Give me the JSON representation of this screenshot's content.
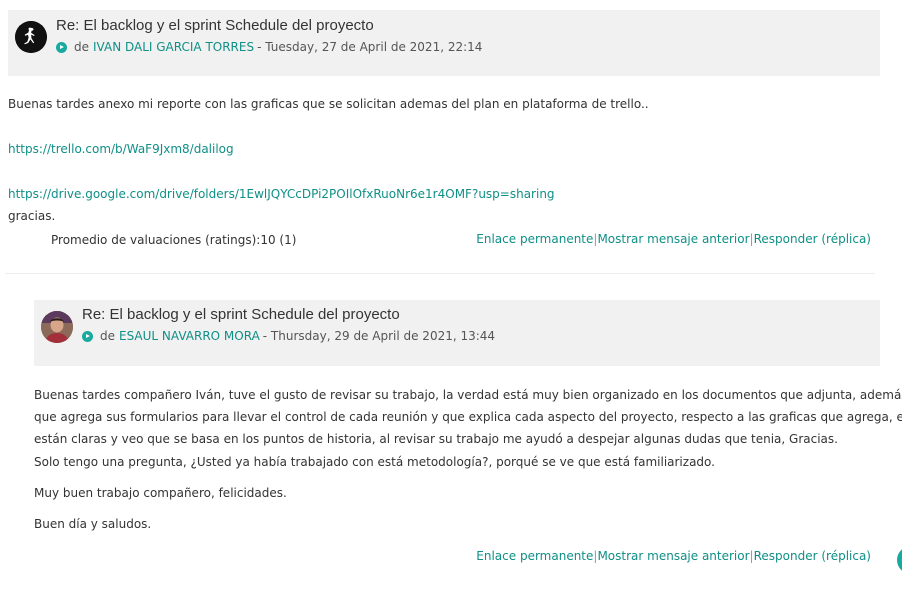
{
  "posts": [
    {
      "subject": "Re: El backlog y el sprint Schedule del proyecto",
      "by_prefix": "de",
      "author": "IVAN DALI GARCIA TORRES",
      "date": "- Tuesday, 27 de April de 2021, 22:14",
      "body": {
        "p1": "Buenas tardes anexo mi reporte con las graficas que se solicitan ademas del plan en plataforma de trello..",
        "link1": "https://trello.com/b/WaF9Jxm8/dalilog",
        "link2": "https://drive.google.com/drive/folders/1EwlJQYCcDPi2POIlOfxRuoNr6e1r4OMF?usp=sharing",
        "p2": "gracias."
      },
      "rating": "Promedio de valuaciones (ratings):10 (1)",
      "commands": {
        "permalink": "Enlace permanente",
        "show_parent": "Mostrar mensaje anterior",
        "reply": "Responder (réplica)"
      }
    },
    {
      "subject": "Re: El backlog y el sprint Schedule del proyecto",
      "by_prefix": "de",
      "author": "ESAUL NAVARRO MORA",
      "date": "- Thursday, 29 de April de 2021, 13:44",
      "body": {
        "l1": "Buenas tardes compañero Iván, tuve el gusto de revisar su trabajo, la verdad está muy bien organizado en los documentos que adjunta, además de",
        "l2": "que agrega sus formularios para llevar el control de cada reunión y que explica cada aspecto del proyecto, respecto a las graficas que agrega, estas",
        "l3": "están claras y veo que se basa en los puntos de historia, al revisar su trabajo me ayudó a despejar algunas dudas que tenia, Gracias.",
        "l4": "Solo tengo una pregunta, ¿Usted ya había trabajado con está metodología?, porqué se ve que está familiarizado.",
        "p2": "Muy buen trabajo compañero, felicidades.",
        "p3": "Buen día y saludos."
      },
      "commands": {
        "permalink": "Enlace permanente",
        "show_parent": "Mostrar mensaje anterior",
        "reply": "Responder (réplica)"
      }
    }
  ],
  "icons": {
    "avatar1": "jordan-logo-avatar",
    "avatar2": "person-photo-avatar",
    "author_dot": "user-status-icon"
  },
  "colors": {
    "link": "#0f8f86",
    "header_bg": "#f1f1f1",
    "accent": "#19a99e"
  }
}
